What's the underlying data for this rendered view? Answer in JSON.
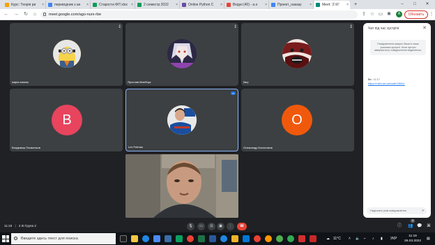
{
  "browser": {
    "tabs": [
      {
        "label": "Курс: Теорія ри",
        "color": "#f4a300"
      },
      {
        "label": "перевод­чик з ан",
        "color": "#4285f4"
      },
      {
        "label": "Старости ФІТ.xlsx",
        "color": "#0f9d58"
      },
      {
        "label": "2 семестр 2022",
        "color": "#0f9d58"
      },
      {
        "label": "Online Python C",
        "color": "#6a4ca5"
      },
      {
        "label": "Вхідні (40) - a.o",
        "color": "#ea4335"
      },
      {
        "label": "Проект_наказу",
        "color": "#4285f4"
      },
      {
        "label": "Meet: 'Z КІ'",
        "color": "#00897b"
      }
    ],
    "url": "meet.google.com/ago-nurx-rbe",
    "update_label": "Обновить",
    "profile_letter": "A"
  },
  "participants": [
    {
      "name": "марія коваль",
      "type": "photo",
      "avatar": "minion-avatar"
    },
    {
      "name": "Ярослав Матійчук",
      "type": "photo",
      "avatar": "anime-avatar"
    },
    {
      "name": "Ilary",
      "type": "photo",
      "avatar": "dark-art-avatar"
    },
    {
      "name": "Владимир Плиженков",
      "type": "letter",
      "letter": "B",
      "color": "#e8445e"
    },
    {
      "name": "Lev Fetman",
      "type": "photo",
      "avatar": "kharkiv-avatar"
    },
    {
      "name": "Олександр Колесніков",
      "type": "letter",
      "letter": "O",
      "color": "#f0590c"
    }
  ],
  "main_video": {
    "label": "camera-feed"
  },
  "chat": {
    "title": "Чат під час зустрічі",
    "note": "Повідомлення можуть бачити лише учасники зустрічі. Коли зустріч завершиться, повідомлення видаляться.",
    "sender": "Ви",
    "time": "11:17",
    "link": "https://rubic.ws.ua/node/13841/",
    "input_placeholder": "Надіслати усім повідомлення"
  },
  "bottom": {
    "time": "11:19",
    "meeting_name": "2 КІ Група 2",
    "people_count": "9"
  },
  "taskbar": {
    "search_placeholder": "Введите здесь текст для поиска",
    "temperature": "11°C",
    "language": "УКР",
    "clock_time": "11:19",
    "clock_date": "26.03.2022"
  }
}
